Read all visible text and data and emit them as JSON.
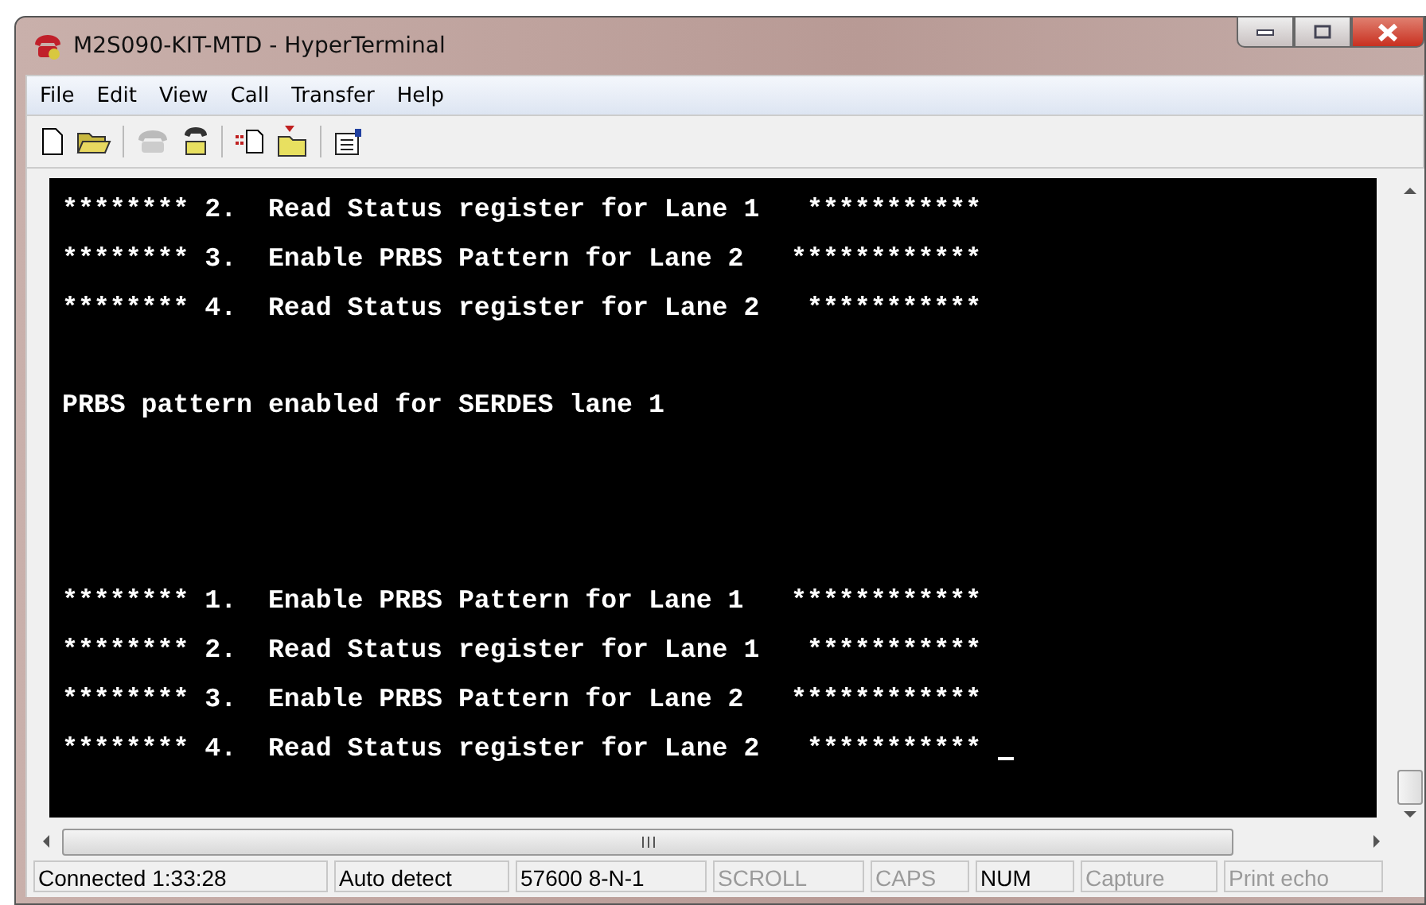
{
  "window": {
    "title": "M2S090-KIT-MTD - HyperTerminal"
  },
  "menu": [
    "File",
    "Edit",
    "View",
    "Call",
    "Transfer",
    "Help"
  ],
  "terminal": {
    "lines": [
      {
        "kind": "text",
        "text": "******** 2.  Read Status register for Lane 1   ***********"
      },
      {
        "kind": "text",
        "text": "******** 3.  Enable PRBS Pattern for Lane 2   ************"
      },
      {
        "kind": "text",
        "text": "******** 4.  Read Status register for Lane 2   ***********"
      },
      {
        "kind": "blank"
      },
      {
        "kind": "text",
        "text": "PRBS pattern enabled for SERDES lane 1"
      },
      {
        "kind": "blank"
      },
      {
        "kind": "blank"
      },
      {
        "kind": "blank"
      },
      {
        "kind": "text",
        "text": "******** 1.  Enable PRBS Pattern for Lane 1   ************"
      },
      {
        "kind": "text",
        "text": "******** 2.  Read Status register for Lane 1   ***********"
      },
      {
        "kind": "text",
        "text": "******** 3.  Enable PRBS Pattern for Lane 2   ************"
      },
      {
        "kind": "text",
        "text": "******** 4.  Read Status register for Lane 2   ***********",
        "cursor": true
      }
    ]
  },
  "status_bar": [
    {
      "text": "Connected 1:33:28",
      "disabled": false
    },
    {
      "text": "Auto detect",
      "disabled": false
    },
    {
      "text": "57600 8-N-1",
      "disabled": false
    },
    {
      "text": "SCROLL",
      "disabled": true
    },
    {
      "text": "CAPS",
      "disabled": true
    },
    {
      "text": "NUM",
      "disabled": false
    },
    {
      "text": "Capture",
      "disabled": true
    },
    {
      "text": "Print echo",
      "disabled": true
    }
  ]
}
